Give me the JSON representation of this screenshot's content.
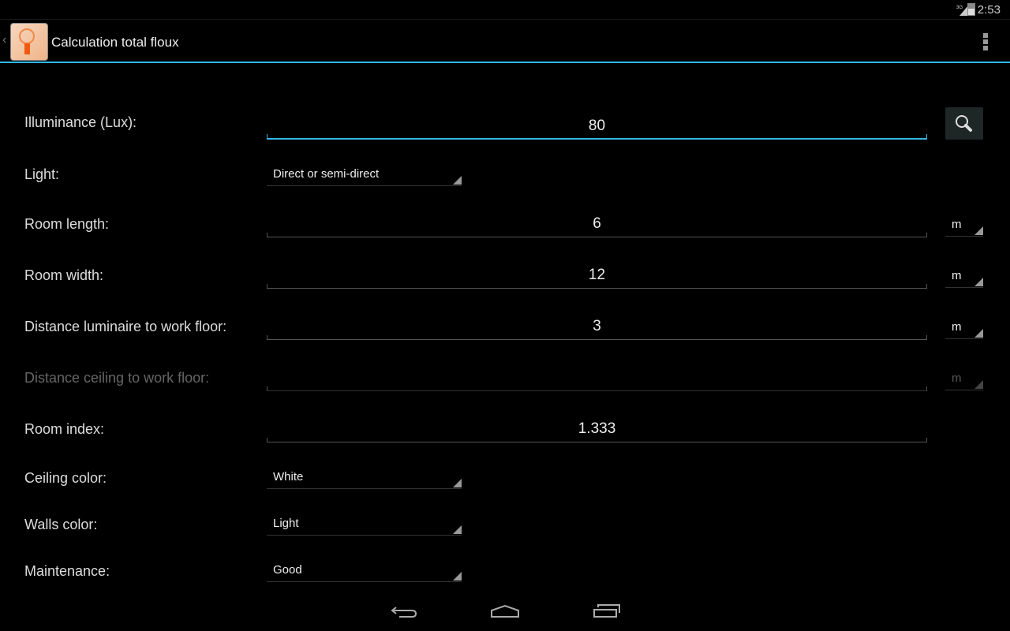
{
  "status_bar": {
    "network": "3G",
    "time": "2:53"
  },
  "action_bar": {
    "title": "Calculation total floux"
  },
  "form": {
    "illuminance": {
      "label": "Illuminance (Lux):",
      "value": "80"
    },
    "light": {
      "label": "Light:",
      "value": "Direct or semi-direct"
    },
    "room_length": {
      "label": "Room length:",
      "value": "6",
      "unit": "m"
    },
    "room_width": {
      "label": "Room width:",
      "value": "12",
      "unit": "m"
    },
    "dist_luminaire": {
      "label": "Distance luminaire to work floor:",
      "value": "3",
      "unit": "m"
    },
    "dist_ceiling": {
      "label": "Distance ceiling to work floor:",
      "value": "",
      "unit": "m"
    },
    "room_index": {
      "label": "Room index:",
      "value": "1.333"
    },
    "ceiling_color": {
      "label": "Ceiling color:",
      "value": "White"
    },
    "walls_color": {
      "label": "Walls color:",
      "value": "Light"
    },
    "maintenance": {
      "label": "Maintenance:",
      "value": "Good"
    }
  },
  "colors": {
    "accent": "#33b5e5",
    "background": "#000000"
  }
}
